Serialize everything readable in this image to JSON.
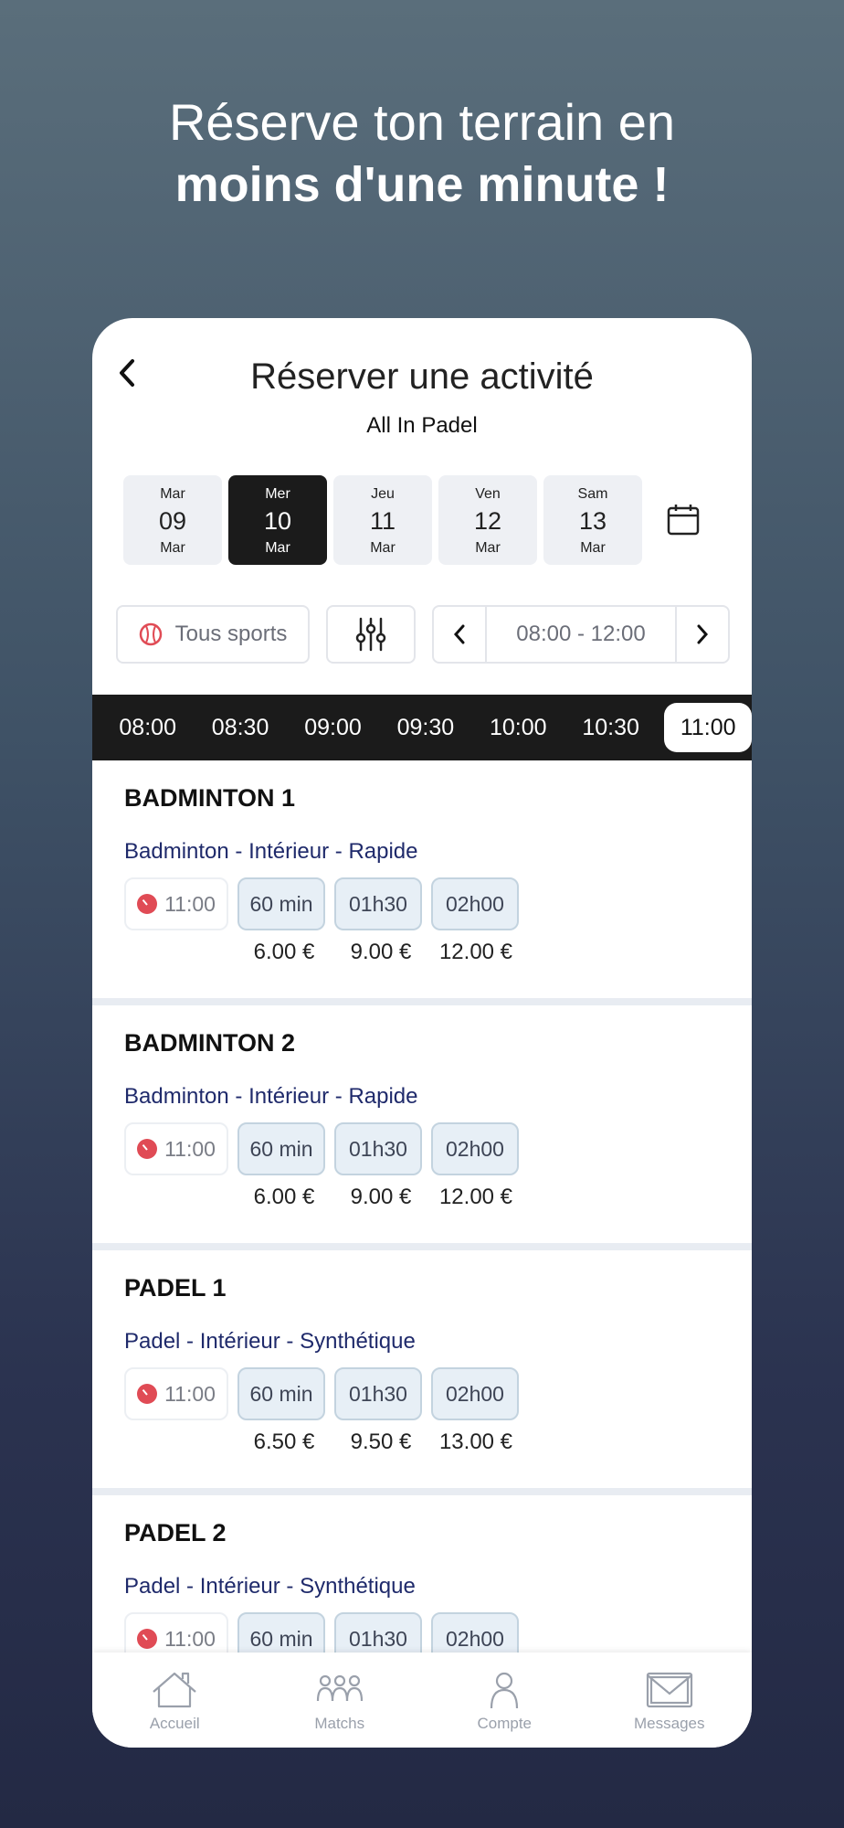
{
  "headline": {
    "line1": "Réserve ton terrain en",
    "line2": "moins d'une minute !"
  },
  "header": {
    "title": "Réserver une activité",
    "subtitle": "All In Padel"
  },
  "days": [
    {
      "name": "Mar",
      "num": "09",
      "month": "Mar",
      "selected": false
    },
    {
      "name": "Mer",
      "num": "10",
      "month": "Mar",
      "selected": true
    },
    {
      "name": "Jeu",
      "num": "11",
      "month": "Mar",
      "selected": false
    },
    {
      "name": "Ven",
      "num": "12",
      "month": "Mar",
      "selected": false
    },
    {
      "name": "Sam",
      "num": "13",
      "month": "Mar",
      "selected": false
    }
  ],
  "filters": {
    "sport_label": "Tous sports",
    "time_range": "08:00 - 12:00"
  },
  "time_slots": [
    "08:00",
    "08:30",
    "09:00",
    "09:30",
    "10:00",
    "10:30",
    "11:00"
  ],
  "active_time_slot": "11:00",
  "courts": [
    {
      "name": "BADMINTON 1",
      "type": "Badminton - Intérieur  - Rapide",
      "time": "11:00",
      "durations": [
        "60 min",
        "01h30",
        "02h00"
      ],
      "prices": [
        "6.00 €",
        "9.00 €",
        "12.00 €"
      ]
    },
    {
      "name": "BADMINTON 2",
      "type": "Badminton - Intérieur  - Rapide",
      "time": "11:00",
      "durations": [
        "60 min",
        "01h30",
        "02h00"
      ],
      "prices": [
        "6.00 €",
        "9.00 €",
        "12.00 €"
      ]
    },
    {
      "name": "PADEL 1",
      "type": "Padel - Intérieur  - Synthétique",
      "time": "11:00",
      "durations": [
        "60 min",
        "01h30",
        "02h00"
      ],
      "prices": [
        "6.50 €",
        "9.50 €",
        "13.00 €"
      ]
    },
    {
      "name": "PADEL 2",
      "type": "Padel - Intérieur  - Synthétique",
      "time": "11:00",
      "durations": [
        "60 min",
        "01h30",
        "02h00"
      ],
      "prices": []
    }
  ],
  "nav": [
    {
      "label": "Accueil",
      "icon": "home-icon"
    },
    {
      "label": "Matchs",
      "icon": "group-icon"
    },
    {
      "label": "Compte",
      "icon": "user-icon"
    },
    {
      "label": "Messages",
      "icon": "mail-icon"
    }
  ],
  "colors": {
    "accent_dark": "#1b1b1b",
    "court_type_text": "#1f2a6b",
    "clock_red": "#e04b55",
    "duration_bg": "#e7eff6"
  }
}
